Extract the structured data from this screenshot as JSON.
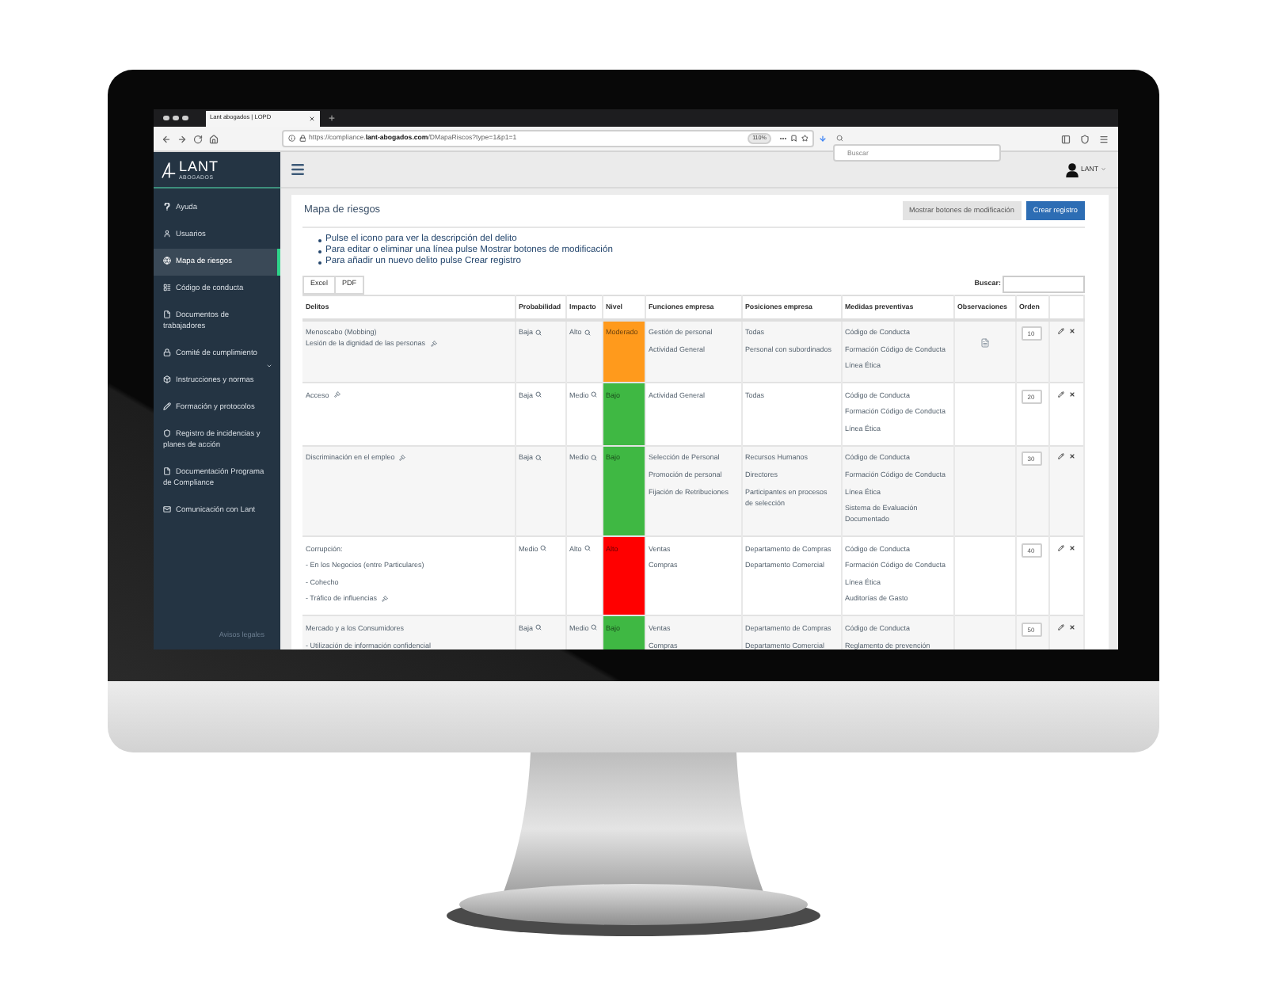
{
  "browser": {
    "tab_title": "Lant abogados | LOPD",
    "url": "https://compliance.**lant-abogados.com**/DMapaRiscos?type=1&p1=1",
    "zoom_level": "110%",
    "search_placeholder": "Buscar"
  },
  "header": {
    "logo": {
      "name": "LANT",
      "subtitle": "ABOGADOS"
    },
    "user": "LANT"
  },
  "sidebar": {
    "items": [
      {
        "label": "Ayuda",
        "selected": false,
        "submenu": false
      },
      {
        "label": "Usuarios",
        "selected": false,
        "submenu": false
      },
      {
        "label": "Mapa de riesgos",
        "selected": true,
        "submenu": false
      },
      {
        "label": "Código de conducta",
        "selected": false,
        "submenu": false
      },
      {
        "label": "Documentos de trabajadores",
        "selected": false,
        "submenu": false
      },
      {
        "label": "Comité de cumplimiento",
        "selected": false,
        "submenu": true
      },
      {
        "label": "Instrucciones y normas",
        "selected": false,
        "submenu": false
      },
      {
        "label": "Formación y protocolos",
        "selected": false,
        "submenu": false
      },
      {
        "label": "Registro de incidencias y planes de acción",
        "selected": false,
        "submenu": false
      },
      {
        "label": "Documentación Programa de Compliance",
        "selected": false,
        "submenu": false
      },
      {
        "label": "Comunicación con Lant",
        "selected": false,
        "submenu": false
      }
    ],
    "footer": "Avisos legales"
  },
  "page": {
    "title": "Mapa de riesgos",
    "buttons": [
      {
        "label": "Mostrar botones de modificación",
        "kind": "secondary"
      },
      {
        "label": "Crear registro",
        "kind": "primary"
      }
    ],
    "instructions": [
      "Pulse el icono para ver la descripción del delito",
      "Para editar o eliminar una línea pulse Mostrar botones de modificación",
      "Para añadir un nuevo delito pulse Crear registro"
    ],
    "export_buttons": [
      "Excel",
      "PDF"
    ],
    "search_label": "Buscar:"
  },
  "table": {
    "columns": [
      "Delitos",
      "Probabilidad",
      "Impacto",
      "Nivel",
      "Funciones empresa",
      "Posiciones empresa",
      "Medidas preventivas",
      "Observaciones",
      "Orden"
    ],
    "rows": [
      {
        "delitos": [
          {
            "lines": [
              "Menoscabo (Mobbing)",
              "Lesión de la dignidad de las personas"
            ],
            "gavel": true
          }
        ],
        "probabilidad": "Baja",
        "impacto": "Alto",
        "nivel": {
          "label": "Moderado",
          "color": "#ff9a1c"
        },
        "funciones": [
          "Gestión de personal",
          "Actividad General"
        ],
        "posiciones": [
          "Todas",
          "Personal con subordinados"
        ],
        "medidas": [
          "Código de Conducta",
          "Formación Código de Conducta",
          "Línea Ética"
        ],
        "observation_doc": true,
        "orden": "10"
      },
      {
        "delitos": [
          {
            "lines": [
              "Acceso"
            ],
            "gavel": true
          }
        ],
        "probabilidad": "Baja",
        "impacto": "Medio",
        "nivel": {
          "label": "Bajo",
          "color": "#3fb843"
        },
        "funciones": [
          "Actividad General"
        ],
        "posiciones": [
          "Todas"
        ],
        "medidas": [
          "Código de Conducta",
          "Formación Código de Conducta",
          "Línea Ética"
        ],
        "observation_doc": false,
        "orden": "20"
      },
      {
        "delitos": [
          {
            "lines": [
              "Discriminación en el empleo"
            ],
            "gavel": true
          }
        ],
        "probabilidad": "Baja",
        "impacto": "Medio",
        "nivel": {
          "label": "Bajo",
          "color": "#3fb843"
        },
        "funciones": [
          "Selección de Personal",
          "Promoción de personal",
          "Fijación de Retribuciones"
        ],
        "posiciones": [
          "Recursos Humanos",
          "Directores",
          "Participantes en procesos de selección"
        ],
        "medidas": [
          "Código de Conducta",
          "Formación Código de Conducta",
          "Línea Ética",
          "Sistema de Evaluación Documentado"
        ],
        "observation_doc": false,
        "orden": "30"
      },
      {
        "delitos": [
          {
            "lines": [
              "Corrupción:"
            ],
            "gavel": false
          },
          {
            "lines": [
              "- En los Negocios (entre Particulares)"
            ],
            "gavel": false
          },
          {
            "lines": [
              "- Cohecho"
            ],
            "gavel": false
          },
          {
            "lines": [
              "- Tráfico de influencias"
            ],
            "gavel": true
          }
        ],
        "probabilidad": "Medio",
        "impacto": "Alto",
        "nivel": {
          "label": "Alto",
          "color": "#ff0000"
        },
        "funciones": [
          "Ventas",
          "Compras"
        ],
        "posiciones": [
          "Departamento de Compras",
          "Departamento Comercial"
        ],
        "medidas": [
          "Código de Conducta",
          "Formación Código de Conducta",
          "Línea Ética",
          "Auditorías de Gasto"
        ],
        "observation_doc": false,
        "orden": "40"
      },
      {
        "delitos": [
          {
            "lines": [
              "Mercado y a los Consumidores"
            ],
            "gavel": false
          },
          {
            "lines": [
              "- Utilización de información confidencial"
            ],
            "gavel": false
          }
        ],
        "probabilidad": "Baja",
        "impacto": "Medio",
        "nivel": {
          "label": "Bajo",
          "color": "#3fb843"
        },
        "funciones": [
          "Ventas",
          "Compras"
        ],
        "posiciones": [
          "Departamento de Compras",
          "Departamento Comercial"
        ],
        "medidas": [
          "Código de Conducta",
          "Reglamento de prevención"
        ],
        "observation_doc": false,
        "orden": "50"
      }
    ]
  }
}
